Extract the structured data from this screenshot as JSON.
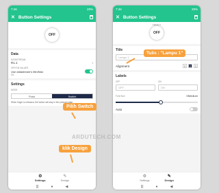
{
  "left": {
    "statusbar": {
      "time": "7:46",
      "battery": "29%"
    },
    "appbar": {
      "title": "Button Settings"
    },
    "preview": {
      "button": "OFF"
    },
    "data_section": {
      "title": "Data",
      "datastream_label": "DATASTREAM",
      "datastream_value": "R1.1",
      "offon_label": "OFF/ON VALUES",
      "offon_value": "Use datastream's Min/Max",
      "offon_sub": "0/1"
    },
    "settings_section": {
      "title": "Settings",
      "mode_label": "MODE",
      "mode_push": "Push",
      "mode_switch": "Switch",
      "note": "When finger is released, the button will stay in the pressed state"
    },
    "tabs": {
      "settings": "Settings",
      "design": "Design"
    }
  },
  "right": {
    "statusbar": {
      "time": "7:46",
      "battery": "29%"
    },
    "appbar": {
      "title": "Button Settings"
    },
    "preview": {
      "tag": "Lampu 1",
      "button": "OFF"
    },
    "title_section": {
      "title": "Title",
      "input_value": "Lampu 1",
      "alignment_label": "Alignment"
    },
    "labels_section": {
      "title": "Labels",
      "off_label": "OFF",
      "off_placeholder": "OFF",
      "on_label": "ON",
      "on_placeholder": "ON",
      "fontsize_label": "Font Size",
      "fontsize_value": "XMedium",
      "auto_label": "Auto"
    },
    "tabs": {
      "settings": "Settings",
      "design": "Design"
    }
  },
  "annotations": {
    "pilih": "Pilih Switch",
    "klik": "klik Design",
    "tulis": "Tulis : \"Lampu 1\"",
    "watermark": "ARDUTECH.COM"
  },
  "font_size_slider_fraction": 0.55,
  "colors": {
    "brand": "#23c48e",
    "dark": "#1e2a48",
    "callout": "#f7a13d"
  },
  "icons": [
    "close-icon",
    "trash-icon",
    "chevron-right-icon",
    "gear-icon",
    "design-icon",
    "back-icon",
    "home-icon",
    "recents-icon"
  ]
}
